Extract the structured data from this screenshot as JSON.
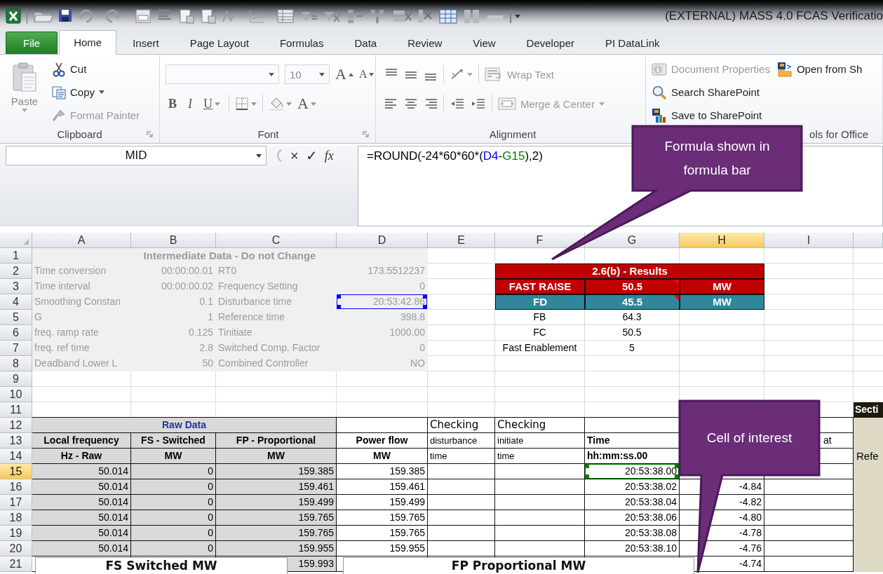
{
  "window": {
    "title": "(EXTERNAL) MASS 4.0 FCAS Verificatio"
  },
  "ribbon_tabs": [
    {
      "label": "File",
      "kind": "file",
      "selected": false
    },
    {
      "label": "Home",
      "kind": "tab",
      "selected": true
    },
    {
      "label": "Insert",
      "kind": "tab",
      "selected": false
    },
    {
      "label": "Page Layout",
      "kind": "tab",
      "selected": false
    },
    {
      "label": "Formulas",
      "kind": "tab",
      "selected": false
    },
    {
      "label": "Data",
      "kind": "tab",
      "selected": false
    },
    {
      "label": "Review",
      "kind": "tab",
      "selected": false
    },
    {
      "label": "View",
      "kind": "tab",
      "selected": false
    },
    {
      "label": "Developer",
      "kind": "tab",
      "selected": false
    },
    {
      "label": "PI DataLink",
      "kind": "tab",
      "selected": false
    }
  ],
  "clipboard": {
    "label": "Clipboard",
    "launcher": true,
    "paste": {
      "label": "Paste",
      "disabled": true
    },
    "commands": [
      {
        "label": "Cut",
        "disabled": false,
        "menu": false
      },
      {
        "label": "Copy",
        "disabled": false,
        "menu": true
      },
      {
        "label": "Format Painter",
        "disabled": true,
        "menu": false
      }
    ]
  },
  "font": {
    "label": "Font",
    "launcher": true,
    "size": "10",
    "grow": "A",
    "shrink": "A",
    "styles": [
      "B",
      "I",
      "U"
    ],
    "color_button": "A"
  },
  "alignment": {
    "label": "Alignment",
    "launcher": false,
    "commands": [
      {
        "label": "Wrap Text",
        "disabled": true,
        "menu": false
      },
      {
        "label": "Merge & Center",
        "disabled": true,
        "menu": true
      }
    ]
  },
  "sharepoint": {
    "label": "ols for Office",
    "commands": [
      {
        "label": "Document Properties",
        "disabled": true
      },
      {
        "label": "Search SharePoint",
        "disabled": false
      },
      {
        "label": "Save to SharePoint",
        "disabled": false
      },
      {
        "label": "Open from Sh",
        "disabled": false
      }
    ]
  },
  "formula_bar": {
    "name_box": "MID",
    "buttons": [
      "×",
      "✓",
      "fx"
    ],
    "formula": [
      {
        "text": "=ROUND(-24*60*60*(",
        "color": "#000000"
      },
      {
        "text": "D4",
        "color": "#0000ff"
      },
      {
        "text": "-",
        "color": "#000000"
      },
      {
        "text": "G15",
        "color": "#008000"
      },
      {
        "text": "),2)",
        "color": "#000000"
      }
    ]
  },
  "sheet": {
    "columns": [
      {
        "label": "A",
        "selected": false
      },
      {
        "label": "B",
        "selected": false
      },
      {
        "label": "C",
        "selected": false
      },
      {
        "label": "D",
        "selected": false
      },
      {
        "label": "E",
        "selected": false
      },
      {
        "label": "F",
        "selected": false
      },
      {
        "label": "G",
        "selected": false
      },
      {
        "label": "H",
        "selected": true
      },
      {
        "label": "I",
        "selected": false
      }
    ],
    "rows": [
      {
        "number": "1",
        "selected": false,
        "boxed": false,
        "cells": {
          "A": {
            "kind": "inter-title",
            "text": "Intermediate Data - Do not Change"
          }
        }
      },
      {
        "number": "2",
        "selected": false,
        "boxed": false,
        "cells": {
          "A": {
            "kind": "inter-label",
            "text": "Time conversion"
          },
          "B": {
            "kind": "inter-value",
            "text": "00:00:00.01"
          },
          "C": {
            "kind": "inter-label",
            "text": "RT0"
          },
          "D": {
            "kind": "inter-value",
            "text": "173.5512237"
          },
          "F": {
            "kind": "result-title",
            "text": "2.6(b) - Results"
          }
        }
      },
      {
        "number": "3",
        "selected": false,
        "boxed": false,
        "cells": {
          "A": {
            "kind": "inter-label",
            "text": "Time interval"
          },
          "B": {
            "kind": "inter-value",
            "text": "00:00:00.02"
          },
          "C": {
            "kind": "inter-label",
            "text": "Frequency Setting"
          },
          "D": {
            "kind": "inter-value",
            "text": "0"
          },
          "F": {
            "kind": "result-red",
            "text": "FAST RAISE"
          },
          "G": {
            "kind": "result-red",
            "text": "50.5",
            "comment": true
          },
          "H": {
            "kind": "result-red",
            "text": "MW"
          }
        }
      },
      {
        "number": "4",
        "selected": false,
        "boxed": false,
        "cells": {
          "A": {
            "kind": "inter-label",
            "text": "Smoothing Constan"
          },
          "B": {
            "kind": "inter-value",
            "text": "0.1"
          },
          "C": {
            "kind": "inter-label",
            "text": "Disturbance time"
          },
          "D": {
            "kind": "inter-value",
            "text": "20:53:42.86",
            "color": "#0000ff"
          },
          "F": {
            "kind": "result-teal",
            "text": "FD"
          },
          "G": {
            "kind": "result-teal",
            "text": "45.5",
            "comment": true
          },
          "H": {
            "kind": "result-teal",
            "text": "MW"
          }
        }
      },
      {
        "number": "5",
        "selected": false,
        "boxed": false,
        "cells": {
          "A": {
            "kind": "inter-label",
            "text": "G"
          },
          "B": {
            "kind": "inter-value",
            "text": "1"
          },
          "C": {
            "kind": "inter-label",
            "text": "Reference time"
          },
          "D": {
            "kind": "inter-value",
            "text": "398.8"
          },
          "F": {
            "kind": "center",
            "text": "FB"
          },
          "G": {
            "kind": "center",
            "text": "64.3"
          }
        }
      },
      {
        "number": "6",
        "selected": false,
        "boxed": false,
        "cells": {
          "A": {
            "kind": "inter-label",
            "text": "freq. ramp rate"
          },
          "B": {
            "kind": "inter-value",
            "text": "0.125"
          },
          "C": {
            "kind": "inter-label",
            "text": "Tinitiate"
          },
          "D": {
            "kind": "inter-value",
            "text": "1000.00"
          },
          "F": {
            "kind": "center",
            "text": "FC"
          },
          "G": {
            "kind": "center",
            "text": "50.5"
          }
        }
      },
      {
        "number": "7",
        "selected": false,
        "boxed": false,
        "cells": {
          "A": {
            "kind": "inter-label",
            "text": "freq. ref time"
          },
          "B": {
            "kind": "inter-value",
            "text": "2.8"
          },
          "C": {
            "kind": "inter-label",
            "text": "Switched Comp. Factor"
          },
          "D": {
            "kind": "inter-value",
            "text": "0"
          },
          "F": {
            "kind": "center",
            "text": "Fast Enablement"
          },
          "G": {
            "kind": "center",
            "text": "5"
          }
        }
      },
      {
        "number": "8",
        "selected": false,
        "boxed": false,
        "cells": {
          "A": {
            "kind": "inter-label",
            "text": "Deadband Lower L"
          },
          "B": {
            "kind": "inter-value",
            "text": "50"
          },
          "C": {
            "kind": "inter-label",
            "text": "Combined Controller"
          },
          "D": {
            "kind": "inter-value",
            "text": "NO"
          }
        }
      },
      {
        "number": "9",
        "selected": false,
        "boxed": false
      },
      {
        "number": "10",
        "selected": false,
        "boxed": false
      },
      {
        "number": "11",
        "selected": false,
        "boxed": false,
        "cells": {
          "J": {
            "kind": "section",
            "text": "Secti"
          }
        }
      },
      {
        "number": "12",
        "selected": false,
        "boxed": true,
        "cells": {
          "A": {
            "kind": "raw-title",
            "text": "Raw Data"
          },
          "E": {
            "kind": "note-big",
            "text": "Checking"
          },
          "F": {
            "kind": "note-big",
            "text": "Checking"
          },
          "J": {
            "kind": "tan"
          }
        }
      },
      {
        "number": "13",
        "selected": false,
        "boxed": true,
        "cells": {
          "A": {
            "kind": "raw-head",
            "text": "Local frequency"
          },
          "B": {
            "kind": "raw-head",
            "text": "FS - Switched"
          },
          "C": {
            "kind": "raw-head",
            "text": "FP - Proportional"
          },
          "D": {
            "kind": "head",
            "text": "Power flow"
          },
          "E": {
            "kind": "note",
            "text": "disturbance"
          },
          "F": {
            "kind": "note",
            "text": "initiate"
          },
          "G": {
            "kind": "time-head",
            "text": "Time"
          },
          "I": {
            "kind": "spill",
            "text": "at"
          },
          "J": {
            "kind": "tan"
          }
        }
      },
      {
        "number": "14",
        "selected": false,
        "boxed": true,
        "cells": {
          "A": {
            "kind": "raw-head",
            "text": "Hz - Raw"
          },
          "B": {
            "kind": "raw-head",
            "text": "MW"
          },
          "C": {
            "kind": "raw-head",
            "text": "MW"
          },
          "D": {
            "kind": "head",
            "text": "MW"
          },
          "E": {
            "kind": "note",
            "text": "time"
          },
          "F": {
            "kind": "note",
            "text": "time"
          },
          "G": {
            "kind": "time-head",
            "text": "hh:mm:ss.00"
          },
          "J": {
            "kind": "tan",
            "text": "Refe"
          }
        }
      },
      {
        "number": "15",
        "selected": true,
        "boxed": true,
        "cells": {
          "A": {
            "kind": "raw-value",
            "text": "50.014"
          },
          "B": {
            "kind": "raw-value",
            "text": "0"
          },
          "C": {
            "kind": "raw-value",
            "text": "159.385"
          },
          "D": {
            "kind": "value",
            "text": "159.385"
          },
          "G": {
            "kind": "value",
            "text": "20:53:38.00",
            "color": "#008000"
          },
          "J": {
            "kind": "tan"
          }
        }
      },
      {
        "number": "16",
        "selected": false,
        "boxed": true,
        "cells": {
          "A": {
            "kind": "raw-value",
            "text": "50.014"
          },
          "B": {
            "kind": "raw-value",
            "text": "0"
          },
          "C": {
            "kind": "raw-value",
            "text": "159.461"
          },
          "D": {
            "kind": "value",
            "text": "159.461"
          },
          "G": {
            "kind": "value",
            "text": "20:53:38.02"
          },
          "H": {
            "kind": "value",
            "text": "-4.84"
          },
          "J": {
            "kind": "tan"
          }
        }
      },
      {
        "number": "17",
        "selected": false,
        "boxed": true,
        "cells": {
          "A": {
            "kind": "raw-value",
            "text": "50.014"
          },
          "B": {
            "kind": "raw-value",
            "text": "0"
          },
          "C": {
            "kind": "raw-value",
            "text": "159.499"
          },
          "D": {
            "kind": "value",
            "text": "159.499"
          },
          "G": {
            "kind": "value",
            "text": "20:53:38.04"
          },
          "H": {
            "kind": "value",
            "text": "-4.82"
          },
          "J": {
            "kind": "tan"
          }
        }
      },
      {
        "number": "18",
        "selected": false,
        "boxed": true,
        "cells": {
          "A": {
            "kind": "raw-value",
            "text": "50.014"
          },
          "B": {
            "kind": "raw-value",
            "text": "0"
          },
          "C": {
            "kind": "raw-value",
            "text": "159.765"
          },
          "D": {
            "kind": "value",
            "text": "159.765"
          },
          "G": {
            "kind": "value",
            "text": "20:53:38.06"
          },
          "H": {
            "kind": "value",
            "text": "-4.80"
          },
          "J": {
            "kind": "tan"
          }
        }
      },
      {
        "number": "19",
        "selected": false,
        "boxed": true,
        "cells": {
          "A": {
            "kind": "raw-value",
            "text": "50.014"
          },
          "B": {
            "kind": "raw-value",
            "text": "0"
          },
          "C": {
            "kind": "raw-value",
            "text": "159.765"
          },
          "D": {
            "kind": "value",
            "text": "159.765"
          },
          "G": {
            "kind": "value",
            "text": "20:53:38.08"
          },
          "H": {
            "kind": "value",
            "text": "-4.78"
          },
          "J": {
            "kind": "tan"
          }
        }
      },
      {
        "number": "20",
        "selected": false,
        "boxed": true,
        "cells": {
          "A": {
            "kind": "raw-value",
            "text": "50.014"
          },
          "B": {
            "kind": "raw-value",
            "text": "0"
          },
          "C": {
            "kind": "raw-value",
            "text": "159.955"
          },
          "D": {
            "kind": "value",
            "text": "159.955"
          },
          "G": {
            "kind": "value",
            "text": "20:53:38.10"
          },
          "H": {
            "kind": "value",
            "text": "-4.76"
          },
          "J": {
            "kind": "tan"
          }
        }
      },
      {
        "number": "21",
        "selected": false,
        "boxed": true,
        "cells": {
          "C": {
            "kind": "raw-value",
            "text": "159.993"
          },
          "H": {
            "kind": "value",
            "text": "-4.74"
          },
          "J": {
            "kind": "tan"
          }
        }
      }
    ]
  },
  "charts": [
    {
      "title": "FS Switched MW"
    },
    {
      "title": "FP Proportional MW"
    }
  ],
  "callouts": [
    {
      "text": "Formula shown in formula bar"
    },
    {
      "text": "Cell of interest"
    }
  ]
}
